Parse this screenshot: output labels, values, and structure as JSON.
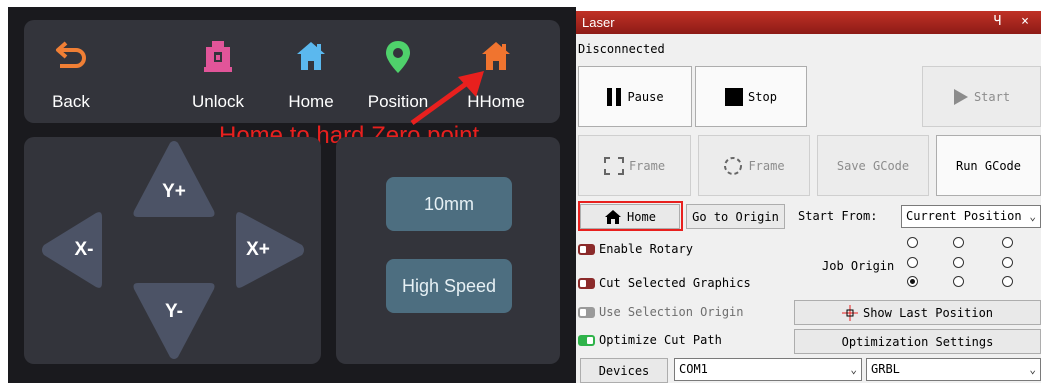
{
  "device": {
    "toolbar": [
      {
        "label": "Back",
        "icon": "back-arrow-icon"
      },
      {
        "label": "Unlock",
        "icon": "unlock-icon"
      },
      {
        "label": "Home",
        "icon": "home-icon"
      },
      {
        "label": "Position",
        "icon": "location-pin-icon"
      },
      {
        "label": "HHome",
        "icon": "hard-home-icon"
      }
    ],
    "jog": {
      "up": "Y+",
      "down": "Y-",
      "left": "X-",
      "right": "X+"
    },
    "step": "10mm",
    "speed": "High Speed",
    "annotation": "Home to hard Zero point",
    "colors": {
      "bg": "#1a1a1e",
      "panel": "#33343b",
      "jog": "#4c5366",
      "button": "#4d6e80",
      "back": "#f07f35",
      "unlock": "#e15599",
      "home": "#5bb8ee",
      "position": "#4fd16b",
      "hhome": "#f0742f",
      "annotation": "#e8201e"
    }
  },
  "laser": {
    "title": "Laser",
    "window_controls": "Ч ×",
    "status": "Disconnected",
    "pause": "Pause",
    "stop": "Stop",
    "start": "Start",
    "frame1": "Frame",
    "frame2": "Frame",
    "save_gcode": "Save GCode",
    "run_gcode": "Run GCode",
    "home": "Home",
    "go_to_origin": "Go to Origin",
    "start_from_label": "Start From:",
    "start_from_value": "Current Position",
    "enable_rotary": "Enable Rotary",
    "cut_selected": "Cut Selected Graphics",
    "use_selection_origin": "Use Selection Origin",
    "optimize_cut_path": "Optimize Cut Path",
    "job_origin_label": "Job Origin",
    "job_origin_selected": "bottom-left",
    "show_last_position": "Show Last Position",
    "optimization_settings": "Optimization Settings",
    "devices": "Devices",
    "port": "COM1",
    "protocol": "GRBL",
    "colors": {
      "title": "#b02a20",
      "toggle_on_red": "#8b2a2a",
      "toggle_on_green": "#2fb34a",
      "toggle_off": "#9a9a9a",
      "highlight": "#e8201e"
    }
  }
}
